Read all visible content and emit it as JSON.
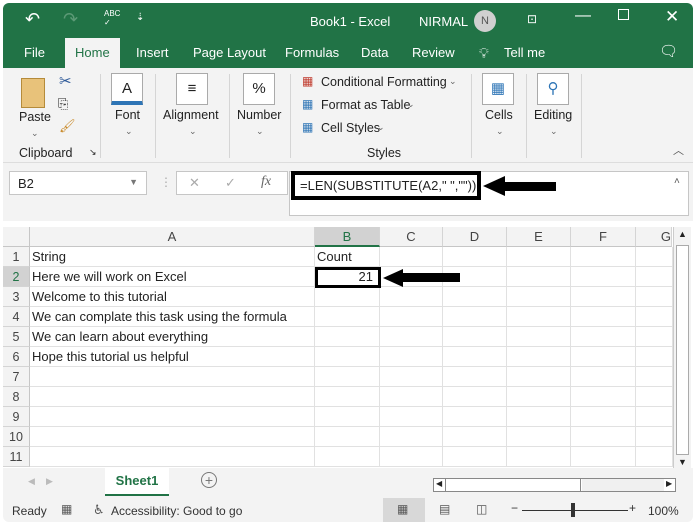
{
  "titlebar": {
    "title": "Book1  -  Excel",
    "user": "NIRMAL",
    "avatar_initial": "N"
  },
  "tabs": [
    {
      "label": "File"
    },
    {
      "label": "Home",
      "active": true
    },
    {
      "label": "Insert"
    },
    {
      "label": "Page Layout"
    },
    {
      "label": "Formulas"
    },
    {
      "label": "Data"
    },
    {
      "label": "Review"
    },
    {
      "label": "Tell me"
    }
  ],
  "ribbon": {
    "paste": "Paste",
    "clipboard": "Clipboard",
    "font": "Font",
    "alignment": "Alignment",
    "number": "Number",
    "conditional": "Conditional Formatting",
    "format_table": "Format as Table",
    "cell_styles": "Cell Styles",
    "styles": "Styles",
    "cells": "Cells",
    "editing": "Editing",
    "font_glyph": "A",
    "number_glyph": "%"
  },
  "formula_bar": {
    "name_box": "B2",
    "fx": "fx",
    "formula": "=LEN(SUBSTITUTE(A2,\" \",\"\"))"
  },
  "columns": [
    "A",
    "B",
    "C",
    "D",
    "E",
    "F",
    "G"
  ],
  "rows": [
    "1",
    "2",
    "3",
    "4",
    "5",
    "6",
    "7",
    "8",
    "9",
    "10",
    "11"
  ],
  "cells": {
    "A1": "String",
    "B1": "Count",
    "A2": "Here we will work on Excel",
    "B2": "21",
    "A3": "Welcome to this tutorial",
    "A4": "We can complate this task using the formula",
    "A5": "We can learn about everything",
    "A6": "Hope this tutorial us helpful"
  },
  "sheet_tabs": [
    {
      "label": "Sheet1",
      "active": true
    }
  ],
  "status": {
    "ready": "Ready",
    "accessibility": "Accessibility: Good to go",
    "zoom": "100%"
  },
  "colors": {
    "accent": "#217346",
    "highlight_box": "#000000"
  }
}
